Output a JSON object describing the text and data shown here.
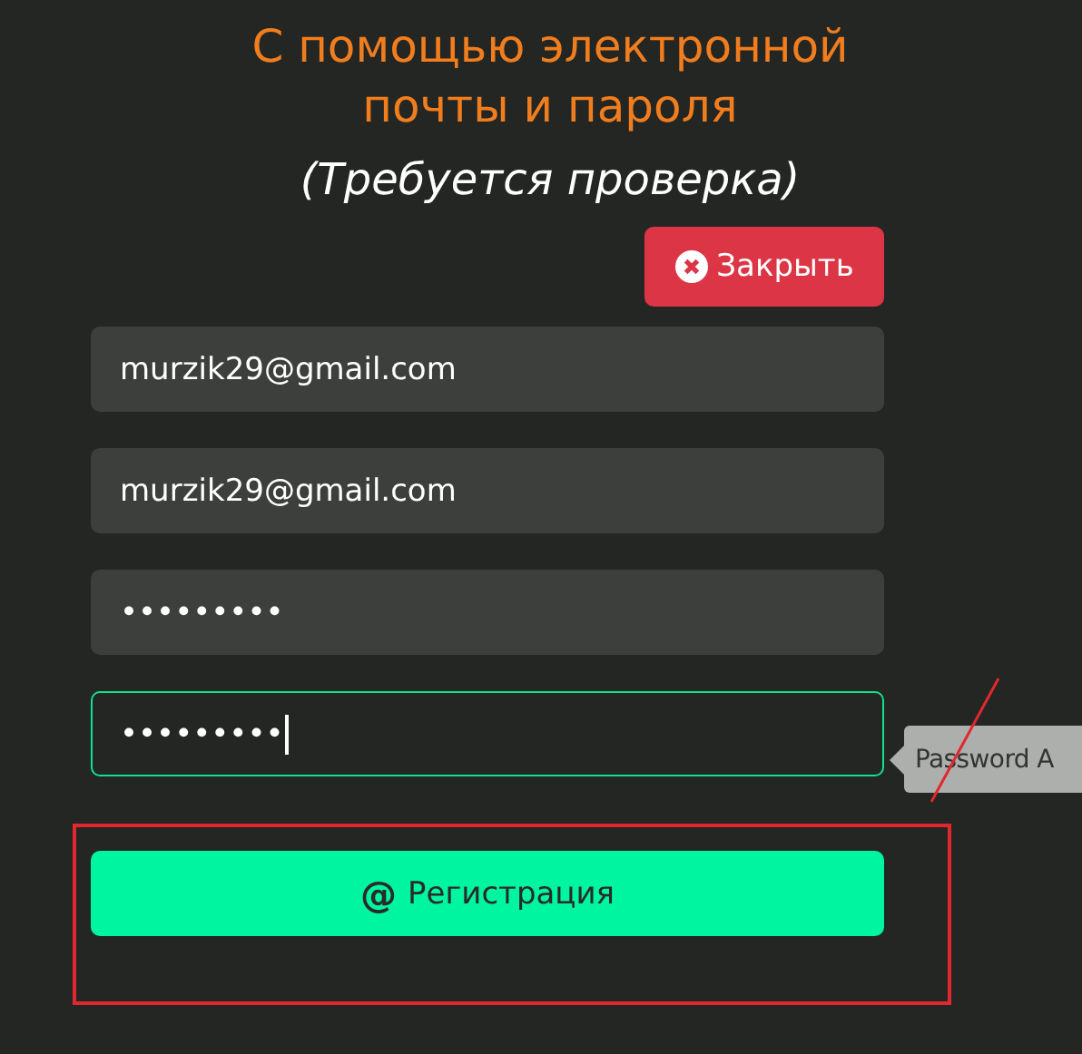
{
  "title_lines": [
    "С помощью электронной",
    "почты и пароля"
  ],
  "subtitle": "(Требуется проверка)",
  "close_button": {
    "label": "Закрыть"
  },
  "fields": [
    {
      "value": "murzik29@gmail.com",
      "focused": false
    },
    {
      "value": "murzik29@gmail.com",
      "focused": false
    },
    {
      "value": "•••••••••",
      "focused": false
    },
    {
      "value": "•••••••••",
      "focused": true
    }
  ],
  "tooltip": "Password A",
  "submit_button": {
    "icon": "@",
    "label": "Регистрация"
  },
  "annotations": {
    "highlight_frame": true,
    "arrow_line": true
  }
}
